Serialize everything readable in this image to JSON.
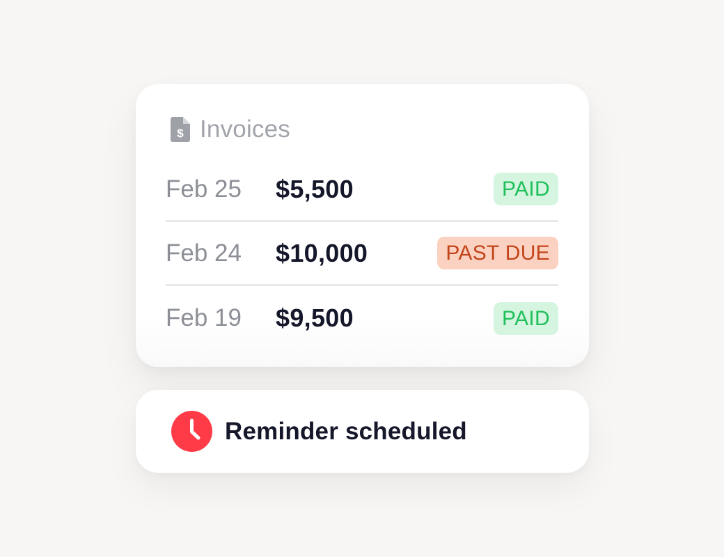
{
  "invoices": {
    "title": "Invoices",
    "icon": "invoice-document-icon",
    "rows": [
      {
        "date": "Feb 25",
        "amount": "$5,500",
        "status": "PAID",
        "status_type": "paid"
      },
      {
        "date": "Feb 24",
        "amount": "$10,000",
        "status": "PAST DUE",
        "status_type": "past_due"
      },
      {
        "date": "Feb 19",
        "amount": "$9,500",
        "status": "PAID",
        "status_type": "paid"
      }
    ]
  },
  "reminder": {
    "text": "Reminder scheduled",
    "icon": "clock-icon"
  },
  "colors": {
    "background": "#f7f6f4",
    "paid_bg": "#d5f5e0",
    "paid_text": "#1fc05a",
    "past_due_bg": "#fbd2c1",
    "past_due_text": "#c3441a",
    "clock_red": "#ff3b47",
    "primary_text": "#15172a",
    "muted_text": "#8d8f97"
  }
}
